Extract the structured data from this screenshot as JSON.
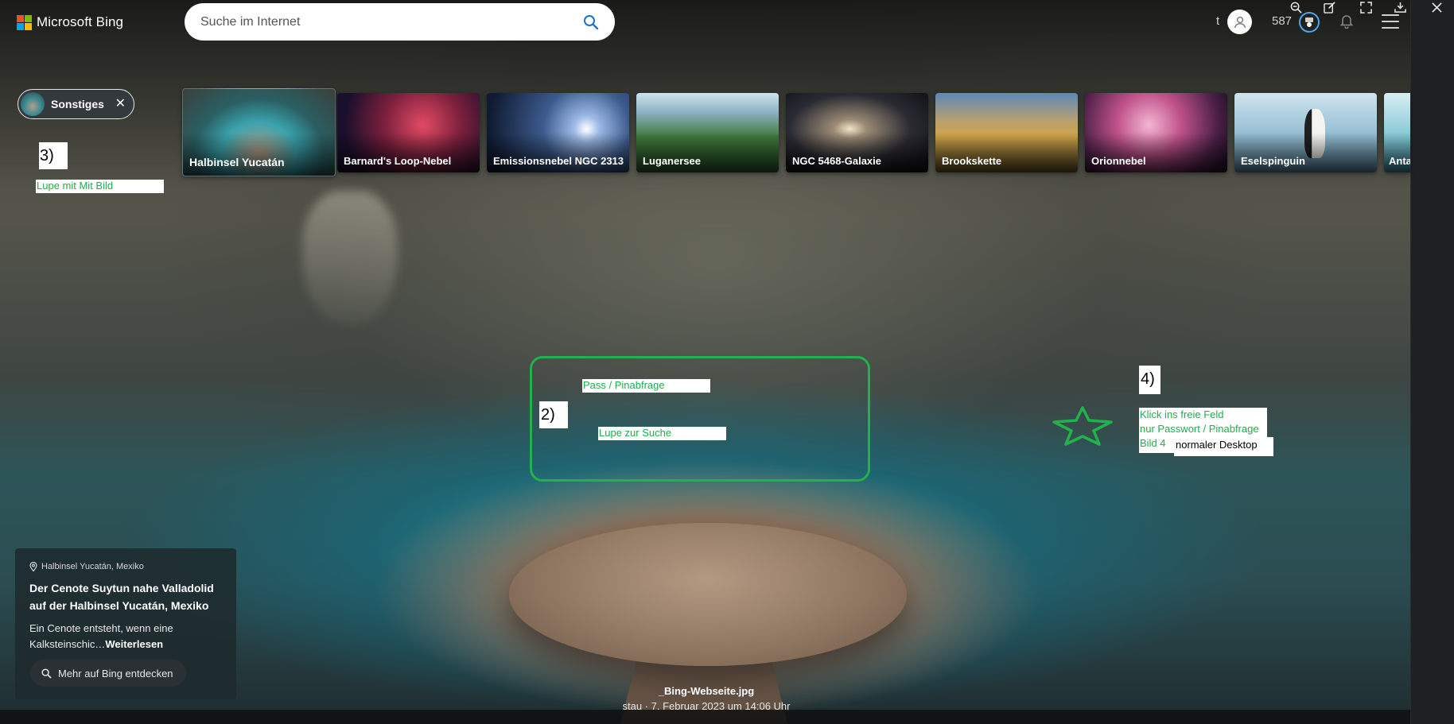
{
  "viewer_toolbar": {
    "icons": [
      "zoom-out-icon",
      "edit-icon",
      "fullscreen-icon",
      "download-icon",
      "close-icon"
    ]
  },
  "header": {
    "logo_text": "Microsoft Bing",
    "search_placeholder": "Suche im Internet",
    "partial_name": "t",
    "points": "587",
    "colors": {
      "logo_red": "#f25022",
      "logo_green": "#7fba00",
      "logo_blue": "#00a4ef",
      "logo_yellow": "#ffb900",
      "reward_ring": "#4aa6f0"
    }
  },
  "chip": {
    "label": "Sonstiges"
  },
  "carousel": [
    {
      "label": "Halbinsel Yucatán",
      "active": true
    },
    {
      "label": "Barnard's Loop-Nebel"
    },
    {
      "label": "Emissionsnebel NGC 2313"
    },
    {
      "label": "Luganersee"
    },
    {
      "label": "NGC 5468-Galaxie"
    },
    {
      "label": "Brookskette"
    },
    {
      "label": "Orionnebel"
    },
    {
      "label": "Eselspinguin"
    },
    {
      "label": "Anta"
    }
  ],
  "annotations": {
    "n3": "3)",
    "n3_note": "Lupe mit Mit Bild",
    "n2": "2)",
    "pass_note": "Pass / Pinabfrage",
    "lupe_note": "Lupe zur Suche",
    "n4": "4)",
    "klick_line1": "Klick ins freie Feld",
    "klick_line2": "nur Passwort / Pinabfrage",
    "klick_line3": "Bild 4",
    "desktop_note": "normaler Desktop",
    "accent": "#22b24c"
  },
  "info": {
    "location": "Halbinsel Yucatán, Mexiko",
    "title": "Der Cenote Suytun nahe Valladolid auf der Halbinsel Yucatán, Mexiko",
    "desc": "Ein Cenote entsteht, wenn eine Kalksteinschic…",
    "more": "Weiterlesen",
    "discover": "Mehr auf Bing entdecken"
  },
  "caption": {
    "filename": "_Bing-Webseite.jpg",
    "meta": "stau · 7. Februar 2023 um 14:06 Uhr"
  }
}
